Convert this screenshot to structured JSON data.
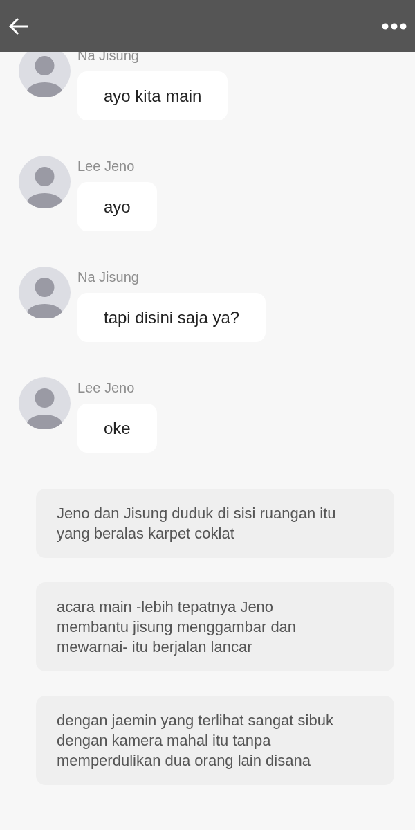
{
  "messages": [
    {
      "sender": "Na Jisung",
      "text": "ayo kita main"
    },
    {
      "sender": "Lee Jeno",
      "text": "ayo"
    },
    {
      "sender": "Na Jisung",
      "text": "tapi disini saja ya?"
    },
    {
      "sender": "Lee Jeno",
      "text": "oke"
    }
  ],
  "narrations": [
    "Jeno dan Jisung duduk di sisi ruangan itu yang beralas karpet coklat",
    "acara main -lebih tepatnya Jeno membantu jisung menggambar dan mewarnai- itu berjalan lancar",
    "dengan jaemin yang terlihat sangat sibuk dengan kamera mahal itu tanpa memperdulikan dua orang lain disana"
  ]
}
